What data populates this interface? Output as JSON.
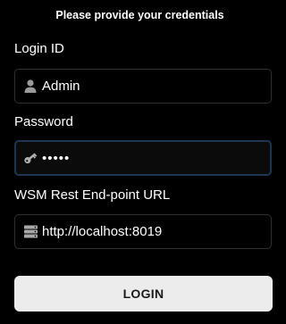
{
  "form": {
    "title": "Please provide your credentials",
    "login_id": {
      "label": "Login ID",
      "value": "Admin",
      "icon": "user-icon"
    },
    "password": {
      "label": "Password",
      "value": "12345",
      "icon": "key-icon"
    },
    "wsm_url": {
      "label": "WSM Rest End-point URL",
      "value": "http://localhost:8019",
      "icon": "server-icon"
    },
    "login_button": "LOGIN"
  },
  "colors": {
    "background": "#000000",
    "field_border": "#2f2f2f",
    "focus_border": "#1d3550",
    "button_bg": "#ececec",
    "button_text": "#1a1a1a"
  }
}
